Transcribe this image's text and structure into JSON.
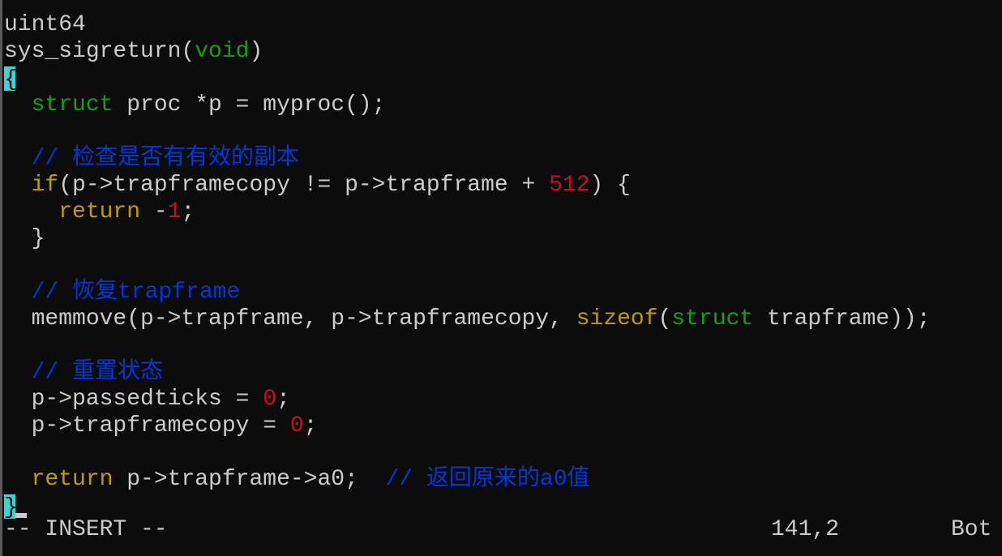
{
  "editor": {
    "lines": [
      [
        {
          "t": "uint64",
          "c": "default"
        }
      ],
      [
        {
          "t": "sys_sigreturn(",
          "c": "default"
        },
        {
          "t": "void",
          "c": "type"
        },
        {
          "t": ")",
          "c": "default"
        }
      ],
      [
        {
          "t": "{",
          "c": "brace-hl"
        }
      ],
      [
        {
          "t": "  ",
          "c": "default"
        },
        {
          "t": "struct",
          "c": "type"
        },
        {
          "t": " proc *p = myproc();",
          "c": "default"
        }
      ],
      [],
      [
        {
          "t": "  // 检查是否有有效的副本",
          "c": "comment"
        }
      ],
      [
        {
          "t": "  ",
          "c": "default"
        },
        {
          "t": "if",
          "c": "keyword"
        },
        {
          "t": "(p->trapframecopy != p->trapframe + ",
          "c": "default"
        },
        {
          "t": "512",
          "c": "number"
        },
        {
          "t": ") {",
          "c": "default"
        }
      ],
      [
        {
          "t": "    ",
          "c": "default"
        },
        {
          "t": "return",
          "c": "keyword"
        },
        {
          "t": " -",
          "c": "default"
        },
        {
          "t": "1",
          "c": "number"
        },
        {
          "t": ";",
          "c": "default"
        }
      ],
      [
        {
          "t": "  }",
          "c": "default"
        }
      ],
      [],
      [
        {
          "t": "  // 恢复trapframe",
          "c": "comment"
        }
      ],
      [
        {
          "t": "  memmove(p->trapframe, p->trapframecopy, ",
          "c": "default"
        },
        {
          "t": "sizeof",
          "c": "keyword"
        },
        {
          "t": "(",
          "c": "default"
        },
        {
          "t": "struct",
          "c": "type"
        },
        {
          "t": " trapframe));",
          "c": "default"
        }
      ],
      [],
      [
        {
          "t": "  // 重置状态",
          "c": "comment"
        }
      ],
      [
        {
          "t": "  p->passedticks = ",
          "c": "default"
        },
        {
          "t": "0",
          "c": "number"
        },
        {
          "t": ";",
          "c": "default"
        }
      ],
      [
        {
          "t": "  p->trapframecopy = ",
          "c": "default"
        },
        {
          "t": "0",
          "c": "number"
        },
        {
          "t": ";",
          "c": "default"
        }
      ],
      [],
      [
        {
          "t": "  ",
          "c": "default"
        },
        {
          "t": "return",
          "c": "keyword"
        },
        {
          "t": " p->trapframe->a0;  ",
          "c": "default"
        },
        {
          "t": "// 返回原来的a0值",
          "c": "comment"
        }
      ],
      [
        {
          "t": "}",
          "c": "brace-hl"
        },
        {
          "t": "",
          "c": "cursor"
        }
      ]
    ]
  },
  "statusbar": {
    "mode": "-- INSERT --",
    "position": "141,2",
    "scroll": "Bot"
  },
  "colors": {
    "background": "#0c0c0c",
    "default": "#cccccc",
    "type": "#13a10e",
    "keyword": "#c19c00",
    "number": "#c50f1f",
    "comment": "#0037da",
    "brace_highlight": "#3ad4d4"
  }
}
